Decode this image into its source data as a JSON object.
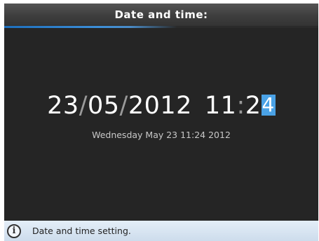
{
  "window": {
    "title": "Date and time:"
  },
  "editor": {
    "day": "23",
    "month": "05",
    "year": "2012",
    "date_separator": "/",
    "hour": "11",
    "time_separator": ":",
    "minute_tens": "2",
    "minute_units_selected": "4",
    "long_date": "Wednesday May 23 11:24 2012"
  },
  "status_bar": {
    "icon": "info-icon",
    "text": "Date and time setting."
  },
  "colors": {
    "background": "#252525",
    "accent": "#3d8fd8",
    "cursor": "#4aa2e6",
    "status_bar": "#d8e5f2"
  }
}
